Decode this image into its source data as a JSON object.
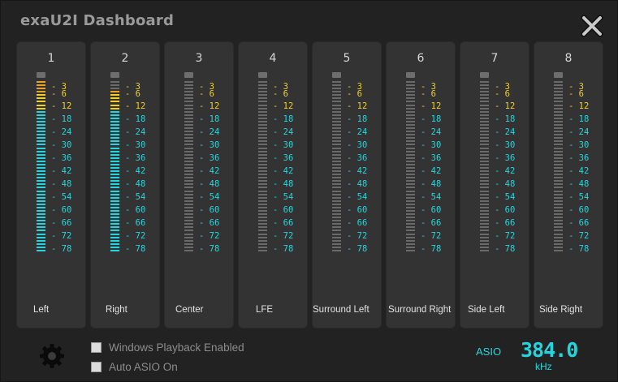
{
  "app": {
    "title": "exaU2I Dashboard"
  },
  "colors": {
    "cyan": "#22d6e0",
    "yellow": "#f0d028",
    "orange": "#f0a020",
    "segment_off": "#6a6a6a",
    "panel": "#333333"
  },
  "icons": {
    "close": "close-x-icon",
    "settings": "gear-icon"
  },
  "scale": [
    "3",
    "6",
    "12",
    "18",
    "24",
    "30",
    "36",
    "42",
    "48",
    "54",
    "60",
    "66",
    "72",
    "78"
  ],
  "channels": [
    {
      "number": "1",
      "label": "Left",
      "level_fraction": 1.0
    },
    {
      "number": "2",
      "label": "Right",
      "level_fraction": 0.94
    },
    {
      "number": "3",
      "label": "Center",
      "level_fraction": 0
    },
    {
      "number": "4",
      "label": "LFE",
      "level_fraction": 0
    },
    {
      "number": "5",
      "label": "Surround Left",
      "level_fraction": 0
    },
    {
      "number": "6",
      "label": "Surround Right",
      "level_fraction": 0
    },
    {
      "number": "7",
      "label": "Side Left",
      "level_fraction": 0
    },
    {
      "number": "8",
      "label": "Side Right",
      "level_fraction": 0
    }
  ],
  "options": {
    "windows_playback": {
      "label": "Windows Playback Enabled",
      "checked": false
    },
    "auto_asio": {
      "label": "Auto ASIO On",
      "checked": false
    }
  },
  "status": {
    "mode": "ASIO",
    "sample_rate": "384.0",
    "unit": "kHz"
  }
}
